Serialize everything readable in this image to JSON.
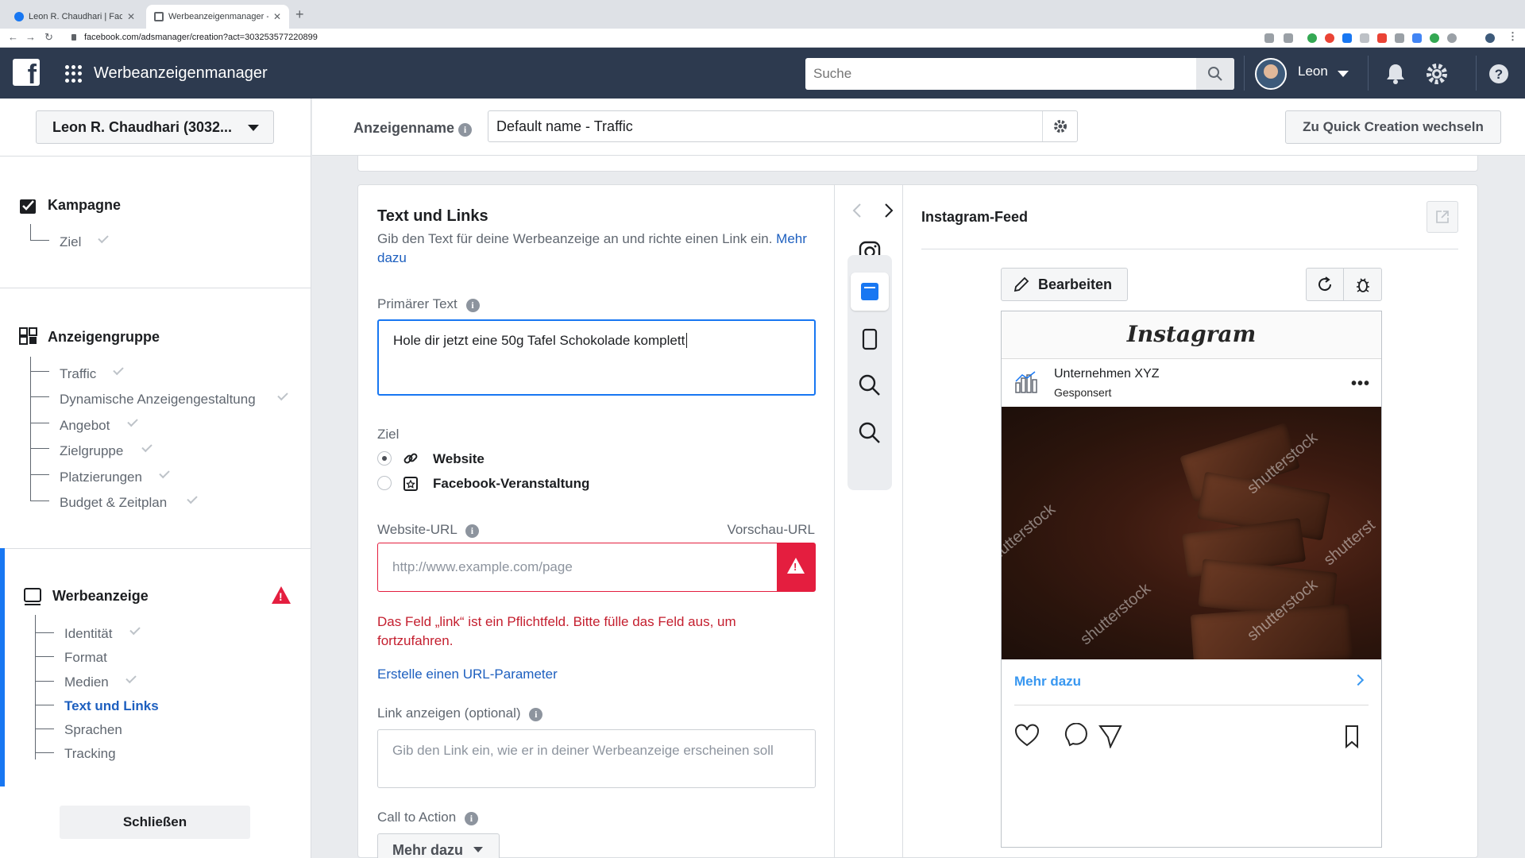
{
  "browser": {
    "tabs": [
      {
        "title": "Leon R. Chaudhari | Facebook"
      },
      {
        "title": "Werbeanzeigenmanager - Crea"
      }
    ],
    "url": "facebook.com/adsmanager/creation?act=303253577220899"
  },
  "header": {
    "app_title": "Werbeanzeigenmanager",
    "search_placeholder": "Suche",
    "user_name": "Leon"
  },
  "sidebar": {
    "account": "Leon R. Chaudhari (3032...",
    "campaign": {
      "title": "Kampagne",
      "items": [
        {
          "label": "Ziel"
        }
      ]
    },
    "adset": {
      "title": "Anzeigengruppe",
      "items": [
        {
          "label": "Traffic"
        },
        {
          "label": "Dynamische Anzeigengestaltung"
        },
        {
          "label": "Angebot"
        },
        {
          "label": "Zielgruppe"
        },
        {
          "label": "Platzierungen"
        },
        {
          "label": "Budget & Zeitplan"
        }
      ]
    },
    "ad": {
      "title": "Werbeanzeige",
      "items": [
        {
          "label": "Identität"
        },
        {
          "label": "Format"
        },
        {
          "label": "Medien"
        },
        {
          "label": "Text und Links"
        },
        {
          "label": "Sprachen"
        },
        {
          "label": "Tracking"
        }
      ]
    },
    "close_label": "Schließen"
  },
  "namebar": {
    "label": "Anzeigenname",
    "value": "Default name - Traffic",
    "quick_creation": "Zu Quick Creation wechseln"
  },
  "form": {
    "title": "Text und Links",
    "description": "Gib den Text für deine Werbeanzeige an und richte einen Link ein.",
    "more_link": "Mehr dazu",
    "primary_text_label": "Primärer Text",
    "primary_text_value": "Hole dir jetzt eine 50g Tafel Schokolade komplett",
    "goal_label": "Ziel",
    "goal_options": [
      {
        "label": "Website",
        "selected": true
      },
      {
        "label": "Facebook-Veranstaltung",
        "selected": false
      }
    ],
    "website_url_label": "Website-URL",
    "preview_url": "Vorschau-URL",
    "website_url_placeholder": "http://www.example.com/page",
    "error": "Das Feld „link“ ist ein Pflichtfeld. Bitte fülle das Feld aus, um fortzufahren.",
    "url_param_link": "Erstelle einen URL-Parameter",
    "display_link_label": "Link anzeigen",
    "display_link_optional": "(optional)",
    "display_link_placeholder": "Gib den Link ein, wie er in deiner Werbeanzeige erscheinen soll",
    "cta_label": "Call to Action",
    "cta_value": "Mehr dazu"
  },
  "preview": {
    "title": "Instagram-Feed",
    "edit_label": "Bearbeiten",
    "ig_brand": "Instagram",
    "account_name": "Unternehmen XYZ",
    "sponsored": "Gesponsert",
    "cta": "Mehr dazu",
    "watermarks": [
      "shutterstock",
      "shutterstock",
      "shutterstock",
      "shutterstock",
      "shutterst",
      "shutterst"
    ]
  },
  "colors": {
    "fb_header": "#2d3a4f",
    "accent": "#1877f2",
    "error": "#e41e3f",
    "link": "#1d5fbf"
  }
}
